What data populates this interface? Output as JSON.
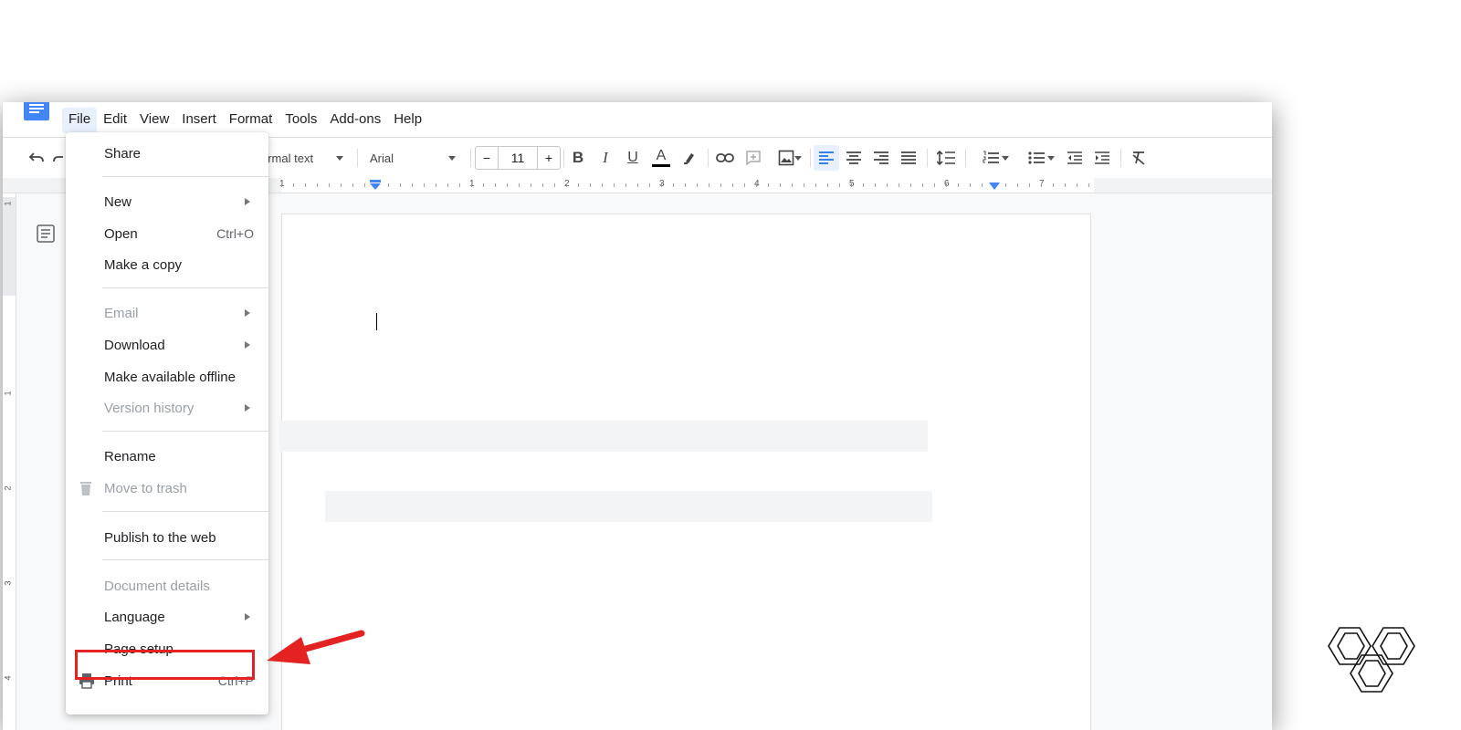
{
  "menubar": {
    "items": [
      "File",
      "Edit",
      "View",
      "Insert",
      "Format",
      "Tools",
      "Add-ons",
      "Help"
    ],
    "active_index": 0
  },
  "toolbar": {
    "paragraph_style": "ormal text",
    "font": "Arial",
    "font_size": "11",
    "decrease": "−",
    "increase": "+",
    "bold": "B",
    "italic": "I",
    "underline": "U",
    "text_color": "A"
  },
  "ruler": {
    "labels": [
      "1",
      "1",
      "2",
      "3",
      "4",
      "5",
      "6",
      "7"
    ],
    "vertical_labels": [
      "1",
      "1",
      "2",
      "3",
      "4"
    ]
  },
  "file_menu": {
    "items": [
      {
        "label": "Share",
        "shortcut": "",
        "submenu": false,
        "disabled": false,
        "icon": ""
      },
      {
        "label": "New",
        "shortcut": "",
        "submenu": true,
        "disabled": false,
        "icon": ""
      },
      {
        "label": "Open",
        "shortcut": "Ctrl+O",
        "submenu": false,
        "disabled": false,
        "icon": ""
      },
      {
        "label": "Make a copy",
        "shortcut": "",
        "submenu": false,
        "disabled": false,
        "icon": ""
      },
      {
        "label": "Email",
        "shortcut": "",
        "submenu": true,
        "disabled": true,
        "icon": ""
      },
      {
        "label": "Download",
        "shortcut": "",
        "submenu": true,
        "disabled": false,
        "icon": ""
      },
      {
        "label": "Make available offline",
        "shortcut": "",
        "submenu": false,
        "disabled": false,
        "icon": ""
      },
      {
        "label": "Version history",
        "shortcut": "",
        "submenu": true,
        "disabled": true,
        "icon": ""
      },
      {
        "label": "Rename",
        "shortcut": "",
        "submenu": false,
        "disabled": false,
        "icon": ""
      },
      {
        "label": "Move to trash",
        "shortcut": "",
        "submenu": false,
        "disabled": true,
        "icon": "trash-icon"
      },
      {
        "label": "Publish to the web",
        "shortcut": "",
        "submenu": false,
        "disabled": false,
        "icon": ""
      },
      {
        "label": "Document details",
        "shortcut": "",
        "submenu": false,
        "disabled": true,
        "icon": ""
      },
      {
        "label": "Language",
        "shortcut": "",
        "submenu": true,
        "disabled": false,
        "icon": ""
      },
      {
        "label": "Page setup",
        "shortcut": "",
        "submenu": false,
        "disabled": false,
        "icon": "",
        "highlighted": true
      },
      {
        "label": "Print",
        "shortcut": "Ctrl+P",
        "submenu": false,
        "disabled": false,
        "icon": "print-icon"
      }
    ]
  },
  "colors": {
    "accent": "#4285f4",
    "highlight_annotation": "#e52222",
    "disabled_text": "#9aa0a6"
  }
}
